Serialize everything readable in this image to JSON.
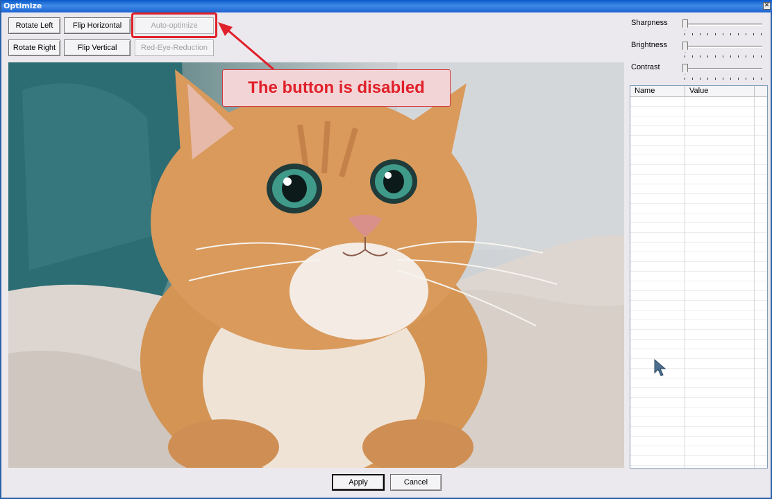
{
  "window": {
    "title": "Optimize"
  },
  "toolbar": {
    "rotate_left": "Rotate Left",
    "flip_horizontal": "Flip Horizontal",
    "auto_optimize": "Auto-optimize",
    "rotate_right": "Rotate Right",
    "flip_vertical": "Flip Vertical",
    "red_eye_reduction": "Red-Eye-Reduction"
  },
  "adjustments": {
    "sharpness": {
      "label": "Sharpness",
      "value": 0
    },
    "brightness": {
      "label": "Brightness",
      "value": 0
    },
    "contrast": {
      "label": "Contrast",
      "value": 0
    }
  },
  "properties": {
    "columns": [
      "Name",
      "Value"
    ],
    "rows": []
  },
  "annotation": {
    "text": "The button is disabled",
    "color": "#e0202a"
  },
  "footer": {
    "apply": "Apply",
    "cancel": "Cancel"
  },
  "colors": {
    "titlebar": "#0a58c9",
    "window_bg": "#ebe9ed",
    "annotation_red": "#e0202a"
  }
}
